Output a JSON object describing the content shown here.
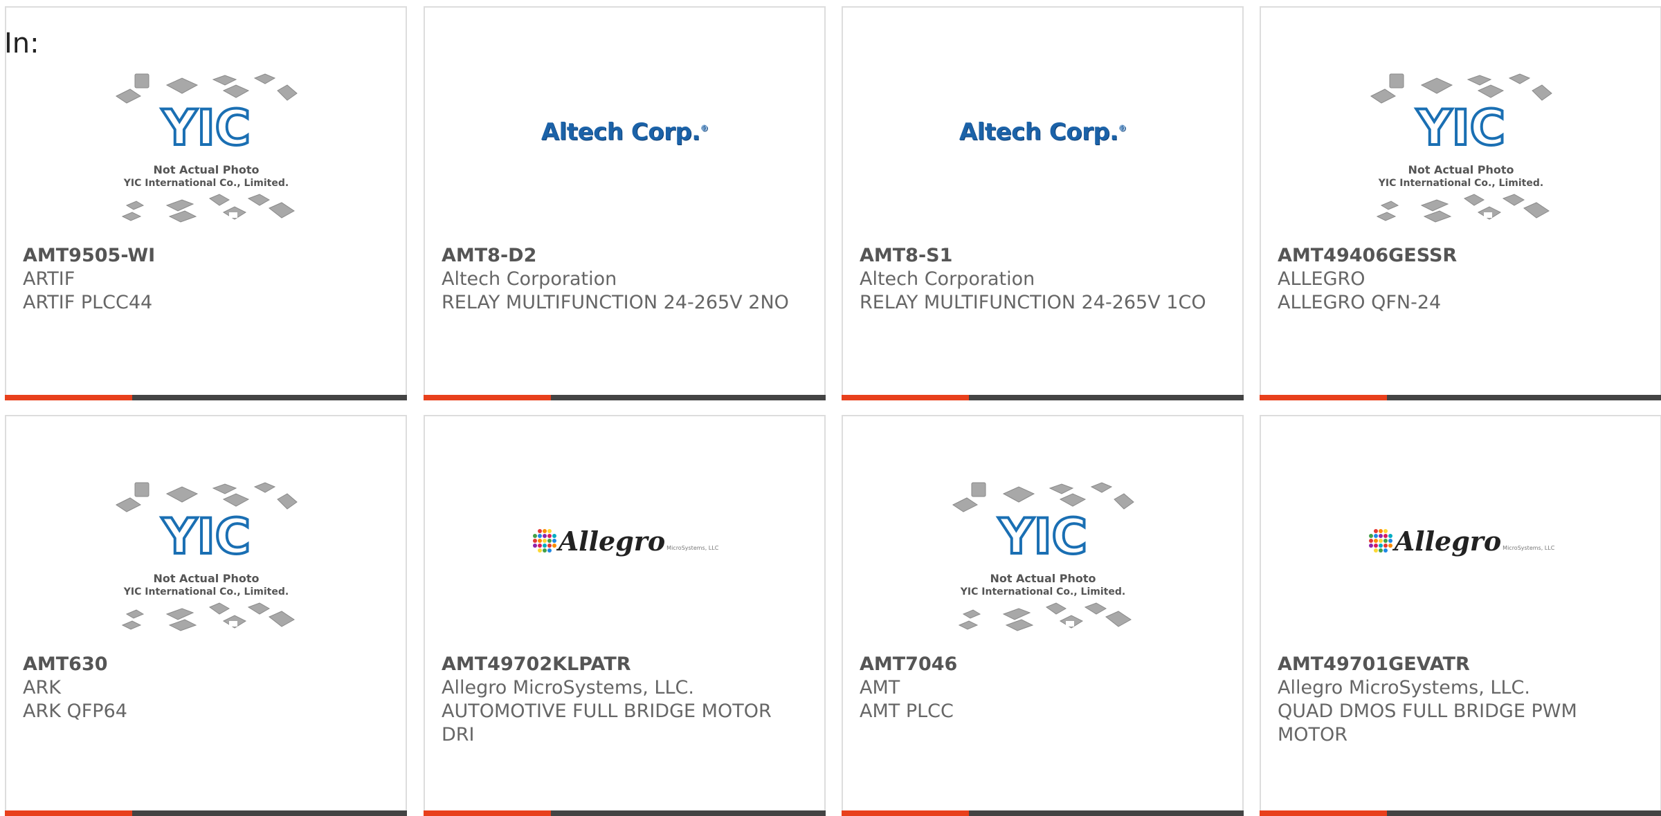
{
  "page": {
    "in_label": "In:"
  },
  "colors": {
    "accent": "#e8401c",
    "bar": "#444444",
    "border": "#dddddd",
    "yic_blue": "#1a6fb3",
    "altech_blue": "#1b62a8"
  },
  "products": [
    {
      "part": "AMT9505-WI",
      "manufacturer": "ARTIF",
      "description": "ARTIF PLCC44",
      "image": "yic-placeholder"
    },
    {
      "part": "AMT8-D2",
      "manufacturer": "Altech Corporation",
      "description": "RELAY MULTIFUNCTION 24-265V 2NO",
      "image": "altech-logo"
    },
    {
      "part": "AMT8-S1",
      "manufacturer": "Altech Corporation",
      "description": "RELAY MULTIFUNCTION 24-265V 1CO",
      "image": "altech-logo"
    },
    {
      "part": "AMT49406GESSR",
      "manufacturer": "ALLEGRO",
      "description": "ALLEGRO QFN-24",
      "image": "yic-placeholder"
    },
    {
      "part": "AMT630",
      "manufacturer": "ARK",
      "description": "ARK QFP64",
      "image": "yic-placeholder"
    },
    {
      "part": "AMT49702KLPATR",
      "manufacturer": "Allegro MicroSystems, LLC.",
      "description": "AUTOMOTIVE FULL BRIDGE MOTOR DRI",
      "image": "allegro-logo"
    },
    {
      "part": "AMT7046",
      "manufacturer": "AMT",
      "description": "AMT PLCC",
      "image": "yic-placeholder"
    },
    {
      "part": "AMT49701GEVATR",
      "manufacturer": "Allegro MicroSystems, LLC.",
      "description": "QUAD DMOS FULL BRIDGE PWM MOTOR",
      "image": "allegro-logo"
    }
  ],
  "yic_placeholder": {
    "brand": "YIC",
    "line1": "Not Actual Photo",
    "line2": "YIC International Co., Limited."
  },
  "altech_logo": {
    "text": "Altech Corp.",
    "mark": "®"
  },
  "allegro_logo": {
    "text": "Allegro",
    "sub": "MicroSystems, LLC"
  }
}
